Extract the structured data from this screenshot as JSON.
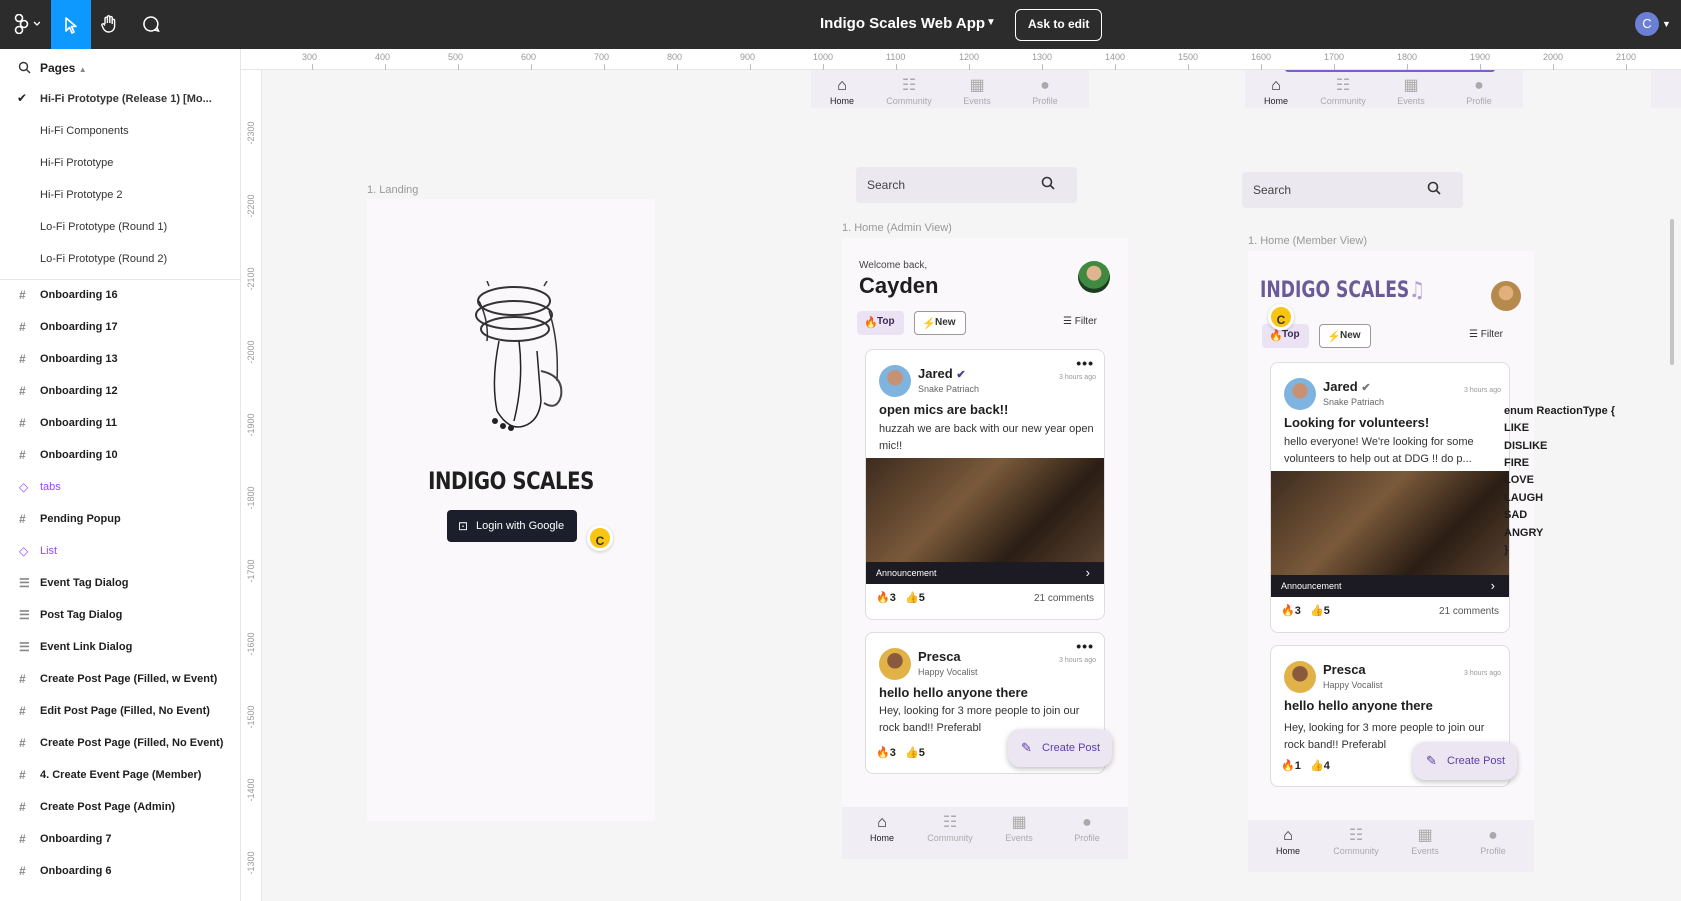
{
  "topbar": {
    "logo_icon": "figma-icon",
    "file_title": "Indigo Scales Web App",
    "ask_button": "Ask to edit",
    "user_initial": "C"
  },
  "sidebar": {
    "pages_label": "Pages",
    "pages": [
      {
        "label": "Hi-Fi Prototype (Release 1) [Mo...",
        "active": true
      },
      {
        "label": "Hi-Fi Components",
        "active": false
      },
      {
        "label": "Hi-Fi Prototype",
        "active": false
      },
      {
        "label": "Hi-Fi Prototype 2",
        "active": false
      },
      {
        "label": "Lo-Fi Prototype (Round 1)",
        "active": false
      },
      {
        "label": "Lo-Fi Prototype (Round 2)",
        "active": false
      }
    ],
    "layers": [
      {
        "label": "Onboarding 16",
        "kind": "frame"
      },
      {
        "label": "Onboarding 17",
        "kind": "frame"
      },
      {
        "label": "Onboarding 13",
        "kind": "frame"
      },
      {
        "label": "Onboarding 12",
        "kind": "frame"
      },
      {
        "label": "Onboarding 11",
        "kind": "frame"
      },
      {
        "label": "Onboarding 10",
        "kind": "frame"
      },
      {
        "label": "tabs",
        "kind": "component"
      },
      {
        "label": "Pending Popup",
        "kind": "frame"
      },
      {
        "label": "List",
        "kind": "component"
      },
      {
        "label": "Event Tag Dialog",
        "kind": "section"
      },
      {
        "label": "Post Tag Dialog",
        "kind": "section"
      },
      {
        "label": "Event Link Dialog",
        "kind": "section"
      },
      {
        "label": "Create Post Page (Filled, w Event)",
        "kind": "frame"
      },
      {
        "label": "Edit Post Page (Filled, No Event)",
        "kind": "frame"
      },
      {
        "label": "Create Post Page (Filled, No Event)",
        "kind": "frame"
      },
      {
        "label": "4. Create Event Page (Member)",
        "kind": "frame"
      },
      {
        "label": "Create Post Page (Admin)",
        "kind": "frame"
      },
      {
        "label": "Onboarding 7",
        "kind": "frame"
      },
      {
        "label": "Onboarding 6",
        "kind": "frame"
      }
    ]
  },
  "ruler": {
    "top": [
      "300",
      "400",
      "500",
      "600",
      "700",
      "800",
      "900",
      "1000",
      "1100",
      "1200",
      "1300",
      "1400",
      "1500",
      "1600",
      "1700",
      "1800",
      "1900",
      "2000",
      "2100"
    ],
    "left": [
      "-2300",
      "-2200",
      "-2100",
      "-2000",
      "-1900",
      "-1800",
      "-1700",
      "-1600",
      "-1500",
      "-1400",
      "-1300"
    ]
  },
  "landing": {
    "frame_label": "1. Landing",
    "brand": "INDIGO SCALES",
    "login_button": "Login with Google",
    "cursor_initial": "C"
  },
  "nav": {
    "home": "Home",
    "community": "Community",
    "events": "Events",
    "profile": "Profile"
  },
  "admin": {
    "frame_label": "1. Home (Admin View)",
    "search_placeholder": "Search",
    "welcome": "Welcome back,",
    "user_name": "Cayden",
    "chip_top": "Top",
    "chip_new": "New",
    "filter": "Filter",
    "fab": "Create Post",
    "posts": [
      {
        "author": "Jared",
        "subtitle": "Snake Patriach",
        "time": "3 hours ago",
        "title": "open mics are back!!",
        "body": "huzzah we are back with our new year open mic!!",
        "tag": "Announcement",
        "fire": "3",
        "likes": "5",
        "comments": "21 comments"
      },
      {
        "author": "Presca",
        "subtitle": "Happy Vocalist",
        "time": "3 hours ago",
        "title": "hello hello anyone there",
        "body": "Hey, looking for 3 more people to join our rock band!! Preferabl",
        "fire": "3",
        "likes": "5"
      }
    ]
  },
  "member": {
    "frame_label": "1. Home (Member View)",
    "search_placeholder": "Search",
    "brand": "INDIGO SCALES",
    "chip_top": "Top",
    "chip_new": "New",
    "filter": "Filter",
    "fab": "Create Post",
    "cursor_initial": "C",
    "posts": [
      {
        "author": "Jared",
        "subtitle": "Snake Patriach",
        "time": "3 hours ago",
        "title": "Looking for volunteers!",
        "body": "hello everyone! We're looking for some volunteers to help out at DDG !! do p...",
        "tag": "Announcement",
        "fire": "3",
        "likes": "5",
        "comments": "21 comments"
      },
      {
        "author": "Presca",
        "subtitle": "Happy Vocalist",
        "time": "3 hours ago",
        "title": "hello hello anyone there",
        "body": "Hey, looking for 3 more people to join our rock band!! Preferabl",
        "fire": "1",
        "likes": "4"
      }
    ]
  },
  "enum_block": [
    "enum ReactionType {",
    "LIKE",
    "DISLIKE",
    "FIRE",
    "LOVE",
    "LAUGH",
    "SAD",
    "ANGRY",
    "}"
  ],
  "colors": {
    "accent": "#0d99ff",
    "brand_purple": "#5b3ea8",
    "component": "#9747ff"
  }
}
